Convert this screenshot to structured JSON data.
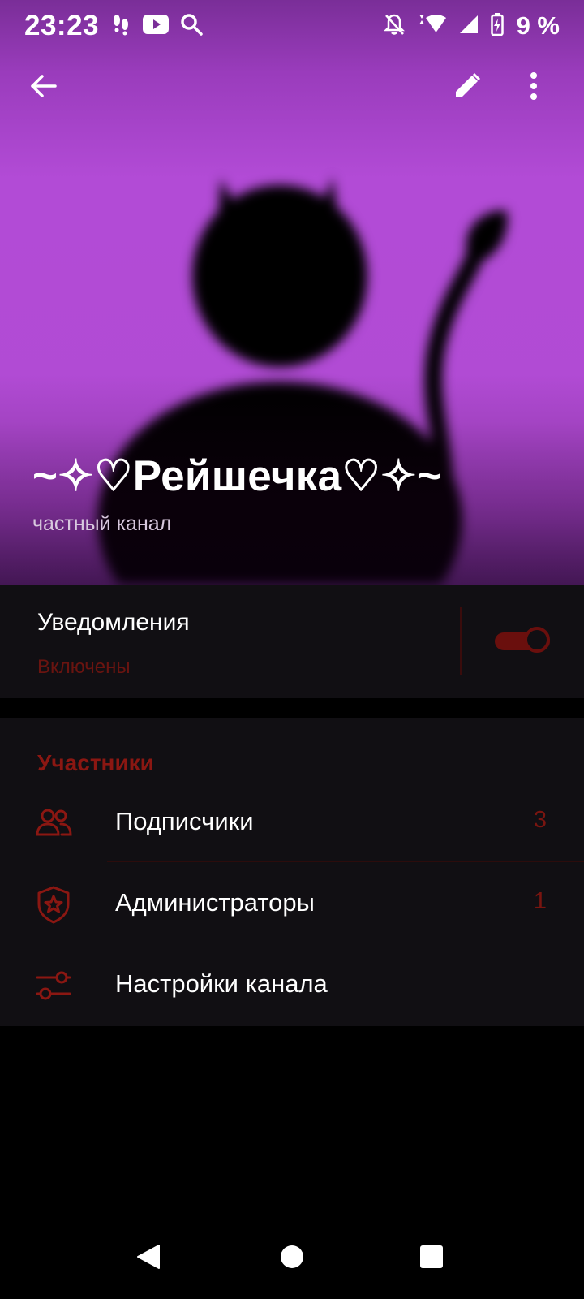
{
  "status_bar": {
    "time": "23:23",
    "battery": "9 %"
  },
  "header": {
    "title": "~✧♡Рейшечка♡✧~",
    "subtitle": "частный канал"
  },
  "notifications": {
    "label": "Уведомления",
    "status": "Включены",
    "enabled": true
  },
  "members": {
    "header": "Участники",
    "items": [
      {
        "label": "Подписчики",
        "count": "3",
        "icon": "users-icon"
      },
      {
        "label": "Администраторы",
        "count": "1",
        "icon": "shield-star-icon"
      },
      {
        "label": "Настройки канала",
        "count": "",
        "icon": "sliders-icon"
      }
    ]
  },
  "colors": {
    "accent": "#8b1712",
    "cover_purple": "#b24bd6",
    "panel_bg": "#110f13"
  }
}
